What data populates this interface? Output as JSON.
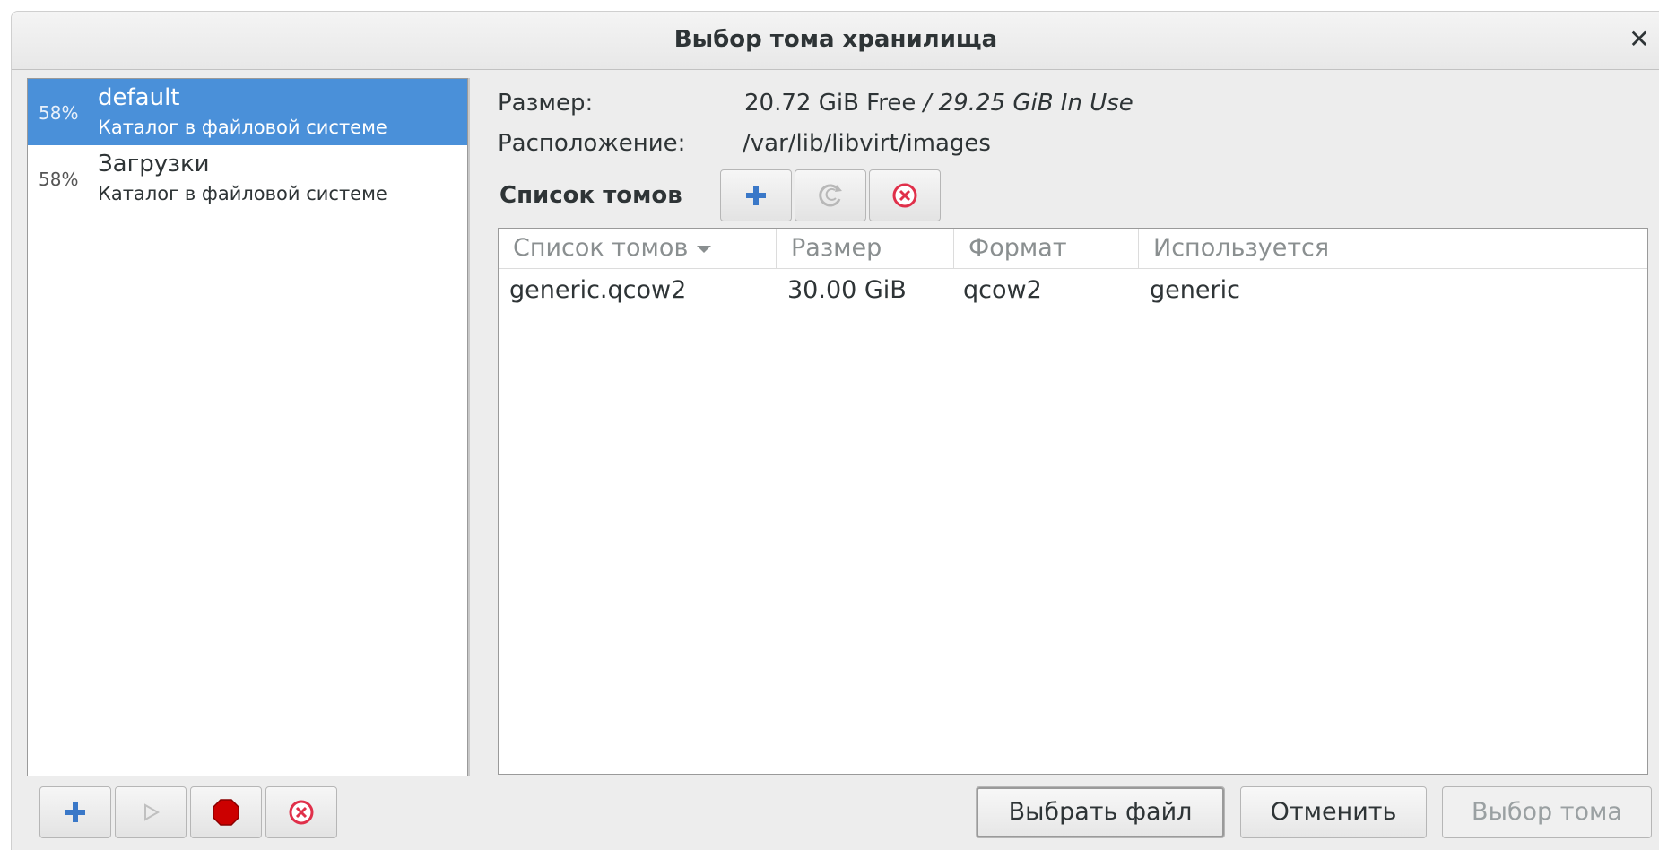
{
  "window": {
    "title": "Выбор тома хранилища"
  },
  "pools": [
    {
      "percent": "58%",
      "name": "default",
      "type": "Каталог в файловой системе",
      "selected": true
    },
    {
      "percent": "58%",
      "name": "Загрузки",
      "type": "Каталог в файловой системе",
      "selected": false
    }
  ],
  "details": {
    "size_label": "Размер:",
    "size_free": "20.72 GiB Free",
    "size_inuse": "/ 29.25 GiB In Use",
    "location_label": "Расположение:",
    "location_value": "/var/lib/libvirt/images"
  },
  "volumes": {
    "header": "Список томов",
    "columns": [
      "Список томов",
      "Размер",
      "Формат",
      "Используется"
    ],
    "rows": [
      {
        "name": "generic.qcow2",
        "size": "30.00 GiB",
        "format": "qcow2",
        "used_by": "generic"
      }
    ]
  },
  "buttons": {
    "browse": "Выбрать файл",
    "cancel": "Отменить",
    "choose": "Выбор тома"
  },
  "icons": {
    "add": "add-icon",
    "refresh": "refresh-icon",
    "delete": "delete-icon",
    "start": "play-icon",
    "stop": "stop-icon"
  },
  "colors": {
    "selection": "#4a90d9",
    "add": "#3a78c8",
    "delete": "#e0304a",
    "stop": "#cc0000"
  }
}
